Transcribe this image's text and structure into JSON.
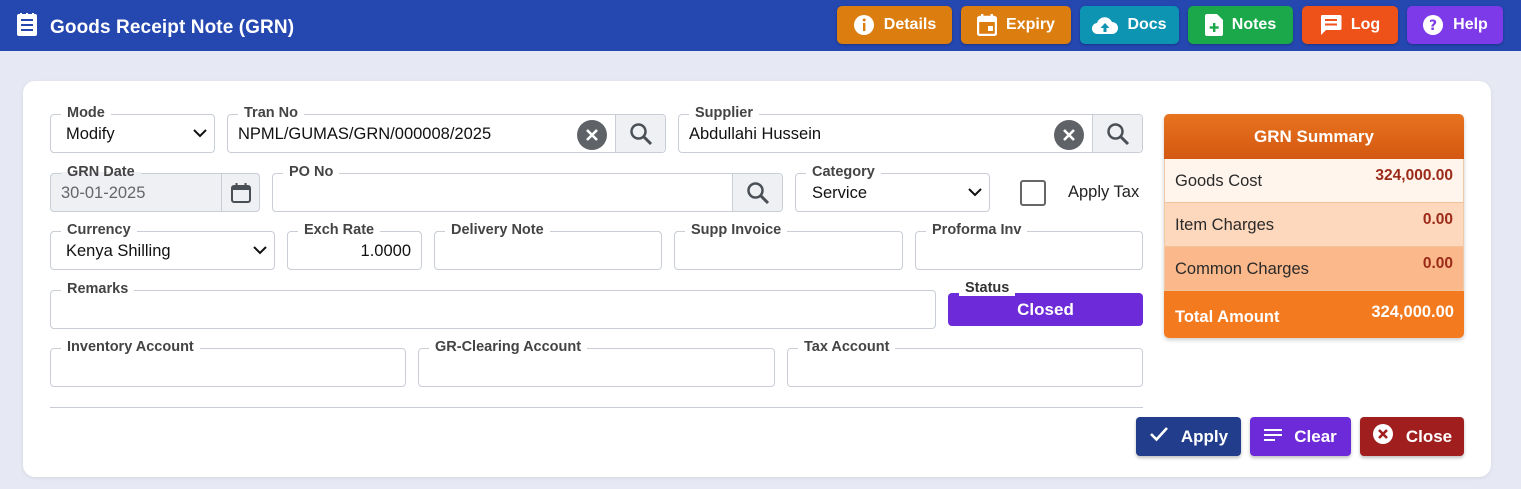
{
  "header": {
    "title": "Goods Receipt Note (GRN)",
    "buttons": [
      {
        "label": "Details",
        "icon": "info-icon",
        "color": "#dc7d10"
      },
      {
        "label": "Expiry",
        "icon": "calendar-icon",
        "color": "#dc7d10"
      },
      {
        "label": "Docs",
        "icon": "cloud-upload-icon",
        "color": "#0e94b3"
      },
      {
        "label": "Notes",
        "icon": "note-add-icon",
        "color": "#1aa84a"
      },
      {
        "label": "Log",
        "icon": "comment-icon",
        "color": "#ef5218"
      },
      {
        "label": "Help",
        "icon": "help-icon",
        "color": "#7d3ae8"
      }
    ]
  },
  "form": {
    "mode": {
      "label": "Mode",
      "value": "Modify"
    },
    "tran_no": {
      "label": "Tran No",
      "value": "NPML/GUMAS/GRN/000008/2025"
    },
    "supplier": {
      "label": "Supplier",
      "value": "Abdullahi Hussein"
    },
    "grn_date": {
      "label": "GRN Date",
      "value": "30-01-2025"
    },
    "po_no": {
      "label": "PO No",
      "value": ""
    },
    "category": {
      "label": "Category",
      "value": "Service"
    },
    "apply_tax": {
      "label": "Apply Tax",
      "checked": false
    },
    "currency": {
      "label": "Currency",
      "value": "Kenya Shilling"
    },
    "exch_rate": {
      "label": "Exch Rate",
      "value": "1.0000"
    },
    "delivery_note": {
      "label": "Delivery Note",
      "value": ""
    },
    "supp_invoice": {
      "label": "Supp Invoice",
      "value": ""
    },
    "proforma_inv": {
      "label": "Proforma Inv",
      "value": ""
    },
    "remarks": {
      "label": "Remarks",
      "value": ""
    },
    "status": {
      "label": "Status",
      "value": "Closed"
    },
    "inventory_account": {
      "label": "Inventory Account",
      "value": ""
    },
    "gr_clearing_account": {
      "label": "GR-Clearing Account",
      "value": ""
    },
    "tax_account": {
      "label": "Tax Account",
      "value": ""
    }
  },
  "summary": {
    "title": "GRN Summary",
    "rows": [
      {
        "label": "Goods Cost",
        "value": "324,000.00"
      },
      {
        "label": "Item Charges",
        "value": "0.00"
      },
      {
        "label": "Common Charges",
        "value": "0.00"
      }
    ],
    "total": {
      "label": "Total Amount",
      "value": "324,000.00"
    }
  },
  "actions": {
    "apply": "Apply",
    "clear": "Clear",
    "close": "Close"
  },
  "colors": {
    "header_bg": "#2447b0",
    "status_bg": "#6d2ad8",
    "apply_bg": "#213d8c",
    "clear_bg": "#6d2ad8",
    "close_bg": "#a11e1e",
    "summary_head": "#d45812",
    "summary_total": "#f47a1f"
  }
}
